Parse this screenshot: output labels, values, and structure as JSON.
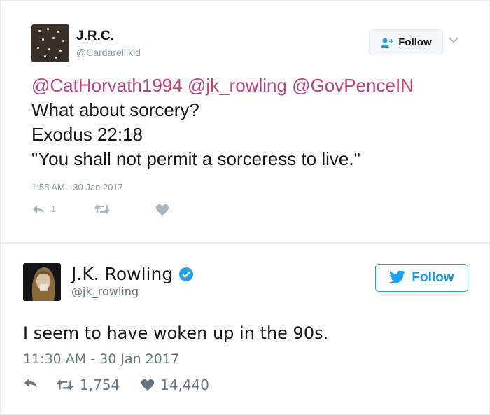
{
  "tweet1": {
    "name": "J.R.C.",
    "handle": "@Cardarellikid",
    "follow_label": "Follow",
    "mentions": "@CatHorvath1994 @jk_rowling @GovPenceIN",
    "lines": [
      "What about sorcery?",
      "Exodus 22:18",
      "\"You shall not permit a sorceress to live.\""
    ],
    "timestamp": "1:55 AM - 30 Jan 2017",
    "reply_count": "1"
  },
  "tweet2": {
    "name": "J.K. Rowling",
    "handle": "@jk_rowling",
    "follow_label": "Follow",
    "text": "I seem to have woken up in the 90s.",
    "timestamp": "11:30 AM - 30 Jan 2017",
    "retweet_count": "1,754",
    "like_count": "14,440"
  },
  "colors": {
    "mention": "#c0427f",
    "twitter_blue": "#1da1f2",
    "muted": "#8899a6"
  }
}
